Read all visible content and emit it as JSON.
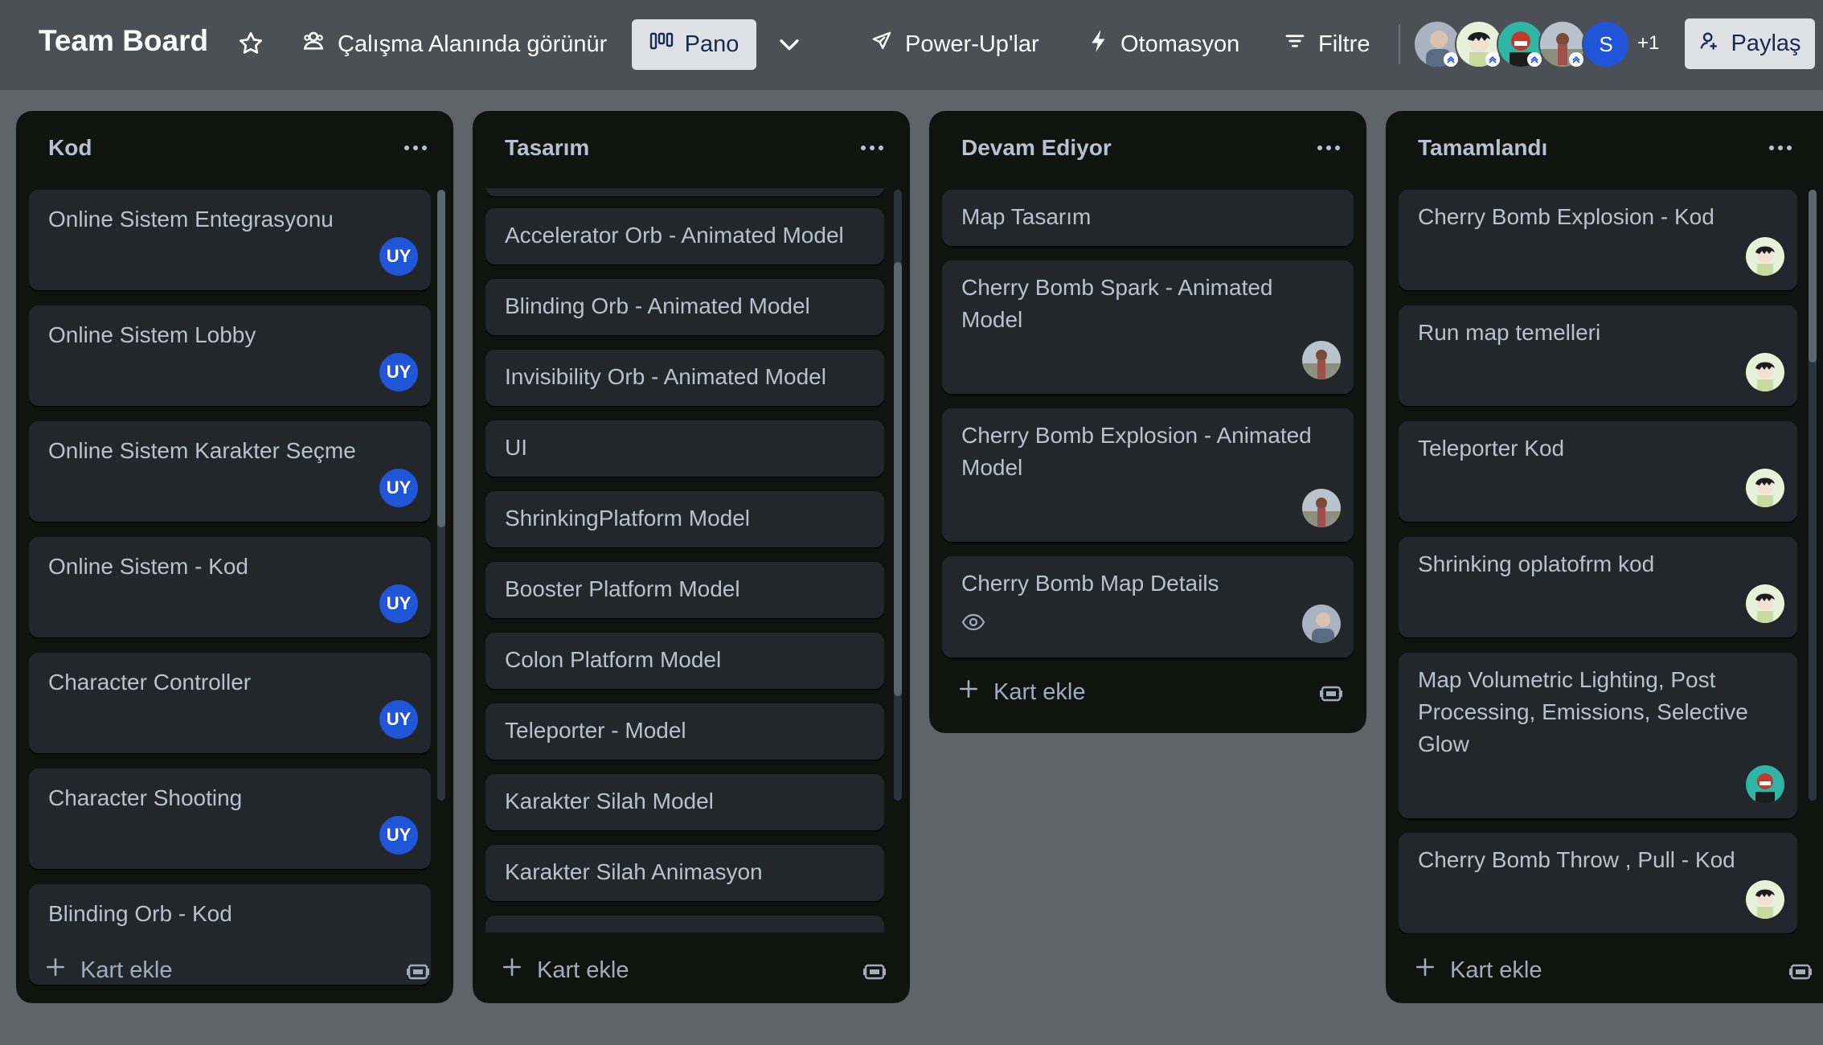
{
  "header": {
    "board_title": "Team Board",
    "visibility_label": "Çalışma Alanında görünür",
    "view_label": "Pano",
    "powerups_label": "Power-Up'lar",
    "automation_label": "Otomasyon",
    "filter_label": "Filtre",
    "member_initial": "S",
    "extra_members": "+1",
    "share_label": "Paylaş"
  },
  "lists": [
    {
      "title": "Kod",
      "add_card_label": "Kart ekle",
      "cards": [
        {
          "title": "Online Sistem Entegrasyonu",
          "member": "UY"
        },
        {
          "title": "Online Sistem Lobby",
          "member": "UY"
        },
        {
          "title": "Online Sistem Karakter Seçme",
          "member": "UY"
        },
        {
          "title": "Online Sistem - Kod",
          "member": "UY"
        },
        {
          "title": "Character Controller",
          "member": "UY"
        },
        {
          "title": "Character Shooting",
          "member": "UY"
        },
        {
          "title": "Blinding Orb - Kod"
        }
      ]
    },
    {
      "title": "Tasarım",
      "add_card_label": "Kart ekle",
      "cards": [
        {
          "title": "Accelerator Orb - Animated Model"
        },
        {
          "title": "Blinding Orb - Animated Model"
        },
        {
          "title": "Invisibility Orb - Animated Model"
        },
        {
          "title": "UI"
        },
        {
          "title": "ShrinkingPlatform Model"
        },
        {
          "title": "Booster Platform Model"
        },
        {
          "title": "Colon Platform Model"
        },
        {
          "title": "Teleporter - Model"
        },
        {
          "title": "Karakter Silah Model"
        },
        {
          "title": "Karakter Silah Animasyon"
        }
      ]
    },
    {
      "title": "Devam Ediyor",
      "add_card_label": "Kart ekle",
      "cards": [
        {
          "title": "Map Tasarım"
        },
        {
          "title": "Cherry Bomb Spark - Animated Model"
        },
        {
          "title": "Cherry Bomb Explosion - Animated Model"
        },
        {
          "title": "Cherry Bomb Map Details"
        }
      ]
    },
    {
      "title": "Tamamlandı",
      "add_card_label": "Kart ekle",
      "cards": [
        {
          "title": "Cherry Bomb Explosion - Kod"
        },
        {
          "title": "Run map temelleri"
        },
        {
          "title": "Teleporter Kod"
        },
        {
          "title": "Shrinking oplatofrm kod"
        },
        {
          "title": "Map Volumetric Lighting, Post Processing, Emissions, Selective Glow"
        },
        {
          "title": "Cherry Bomb Throw , Pull - Kod"
        }
      ]
    }
  ],
  "colors": {
    "header_bg": "#4a5056",
    "board_bg": "#5f6469",
    "list_bg": "#111310",
    "card_bg": "#22272b",
    "card_text": "#b6c2cf",
    "member_badge": "#1f55d6"
  }
}
